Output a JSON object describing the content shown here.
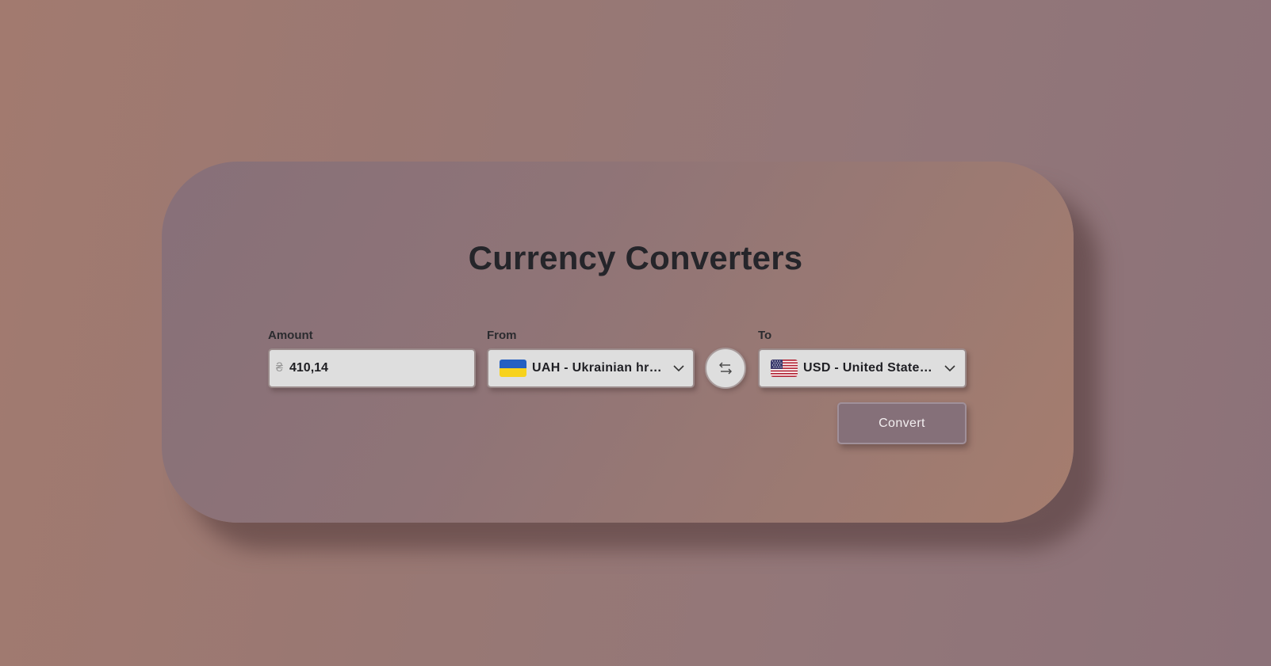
{
  "title": "Currency Converters",
  "amount": {
    "label": "Amount",
    "currency_symbol": "₴",
    "value": "410,14"
  },
  "from": {
    "label": "From",
    "selected": "UAH - Ukrainian hryvnia",
    "flag_icon": "ukraine-flag-icon",
    "flag_colors": [
      "#2460c2",
      "#f7d21c"
    ]
  },
  "swap": {
    "icon": "swap-arrows-icon"
  },
  "to": {
    "label": "To",
    "selected": "USD - United States Dollar",
    "flag_icon": "usa-flag-icon",
    "flag_colors": [
      "#b22234",
      "#ffffff",
      "#3c3b6e"
    ]
  },
  "convert_label": "Convert",
  "colors": {
    "title": "#25252a",
    "field_background": "#dedede",
    "convert_button": "#857079"
  }
}
